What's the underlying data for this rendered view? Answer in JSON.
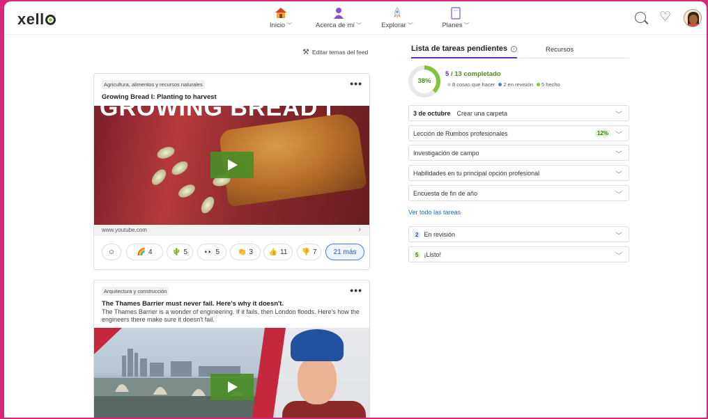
{
  "brand": {
    "logo_text_pre": "xell",
    "accent": "#d9267a"
  },
  "nav": {
    "items": [
      {
        "label": "Inicio",
        "icon": "home-icon"
      },
      {
        "label": "Acerca de mí",
        "icon": "person-icon"
      },
      {
        "label": "Explorar",
        "icon": "rocket-icon"
      },
      {
        "label": "Planes",
        "icon": "notebook-icon"
      }
    ]
  },
  "feed": {
    "edit_label": "Editar temas del feed",
    "cards": [
      {
        "tag": "Agricultura, alimentos y recursos naturales",
        "title": "Growing Bread I: Planting to harvest",
        "overlay_text": "GROWING BREAD I",
        "url": "www.youtube.com",
        "reactions": [
          {
            "emoji": "🌈",
            "count": "4"
          },
          {
            "emoji": "🌵",
            "count": "5"
          },
          {
            "emoji": "👀",
            "count": "5"
          },
          {
            "emoji": "👏",
            "count": "3"
          },
          {
            "emoji": "👍",
            "count": "11"
          },
          {
            "emoji": "👎",
            "count": "7"
          }
        ],
        "more_label": "21 más"
      },
      {
        "tag": "Arquitectura y construcción",
        "title": "The Thames Barrier must never fail. Here's why it doesn't.",
        "description": "The Thames Barrier is a wonder of engineering. If it fails, then London floods. Here's how the engineers there make sure it doesn't fail."
      }
    ]
  },
  "tasks": {
    "tab_active": "Lista de tareas pendientes",
    "tab_other": "Recursos",
    "percent": "38%",
    "done": "5",
    "total_label": "/ 13 completado",
    "legend": {
      "todo": "8 cosas que hacer",
      "review": "2 en revisión",
      "done": "5 hecho"
    },
    "items": [
      {
        "date": "3 de octubre",
        "label": "Crear una carpeta"
      },
      {
        "label": "Lección de Rumbos profesionales",
        "pct": "12%"
      },
      {
        "label": "Investigación de campo"
      },
      {
        "label": "Habilidades en tu principal opción profesional"
      },
      {
        "label": "Encuesta de fin de año"
      }
    ],
    "see_all": "Ver todo las tareas",
    "groups": [
      {
        "count": "2",
        "label": "En revisión"
      },
      {
        "count": "5",
        "label": "¡Listo!"
      }
    ]
  }
}
